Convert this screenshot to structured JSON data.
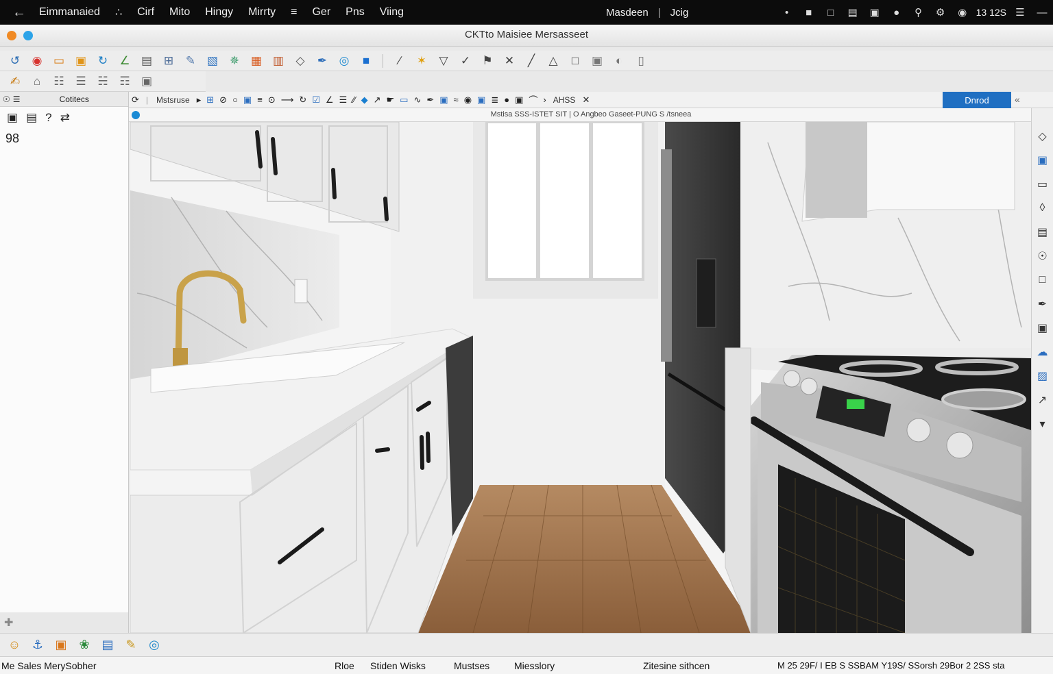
{
  "menubar": {
    "back_icon": "arrow-left-icon",
    "app_name": "Eimmanaied",
    "items": [
      "Cirf",
      "Mito",
      "Hingy",
      "Mirrty",
      "Ger",
      "Pns",
      "Viing"
    ],
    "document_items": [
      "Masdeen",
      "Jcig"
    ],
    "clock": "13 12S",
    "status_icons": [
      "pin-icon",
      "message-icon",
      "window-icon",
      "doc-icon",
      "screen-icon",
      "location-icon",
      "search-icon",
      "settings-icon",
      "wifi-icon"
    ]
  },
  "window": {
    "title": "CKTto Maisiee Mersasseet",
    "traffic_light_colors": [
      "#f08a24",
      "#2ca3e8"
    ]
  },
  "left_panel": {
    "header": "Cotitecs",
    "count": "98"
  },
  "options_bar": {
    "label": "Mstsruse",
    "tool_label": "AHSS",
    "done_button": "Dnrod"
  },
  "info_bar": {
    "text": "Mstisa SSS-ISTET SIT  |  O  Angbeo Gaseet-PUNG  S  /tsneea"
  },
  "status_bar": {
    "left": "Me Sales MerySobher",
    "items": [
      "Rloe",
      "Stiden Wisks",
      "Mustses",
      "Miesslory"
    ],
    "center": "Zitesine sithcen",
    "right": "M 25 29F/ I EB S SSBAM Y19S/ SSorsh 29Bor 2 2SS sta"
  },
  "colors": {
    "menubar_bg": "#0c0c0c",
    "accent": "#1f6fc2",
    "floor": "#9c6f47"
  }
}
